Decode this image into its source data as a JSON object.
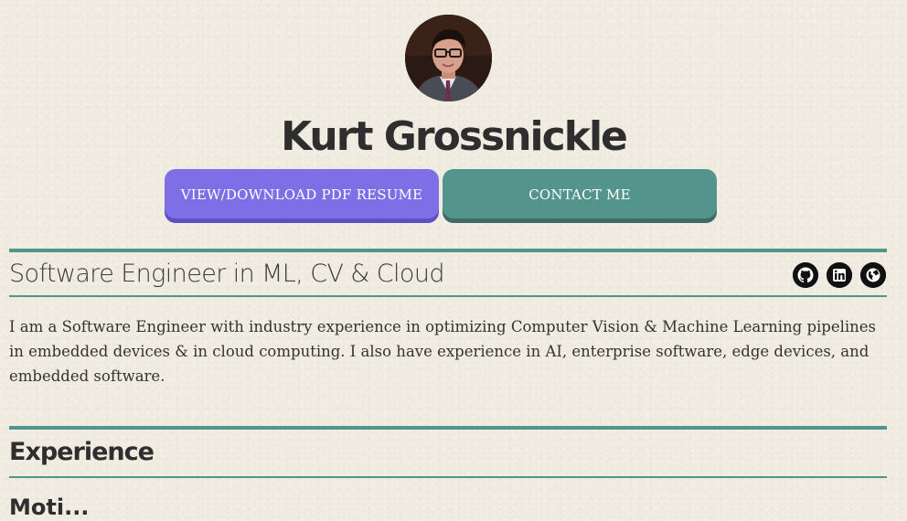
{
  "profile": {
    "name": "Kurt Grossnickle",
    "avatar_alt": "avatar"
  },
  "actions": {
    "resume_label": "VIEW/DOWNLOAD PDF RESUME",
    "contact_label": "CONTACT ME"
  },
  "intro": {
    "tagline": "Software Engineer in ML, CV & Cloud",
    "bio": "I am a Software Engineer with industry experience in optimizing Computer Vision & Machine Learning pipelines in embedded devices & in cloud computing. I also have experience in AI, enterprise software, edge devices, and embedded software."
  },
  "social": {
    "icons": [
      "github-icon",
      "linkedin-icon",
      "globe-icon"
    ]
  },
  "sections": {
    "experience_title": "Experience",
    "first_entry_partial": "Moti..."
  },
  "colors": {
    "accent_teal": "#53958d",
    "accent_purple": "#7e6fe7",
    "background": "#efebe0",
    "text_dark": "#2e2e2e"
  }
}
